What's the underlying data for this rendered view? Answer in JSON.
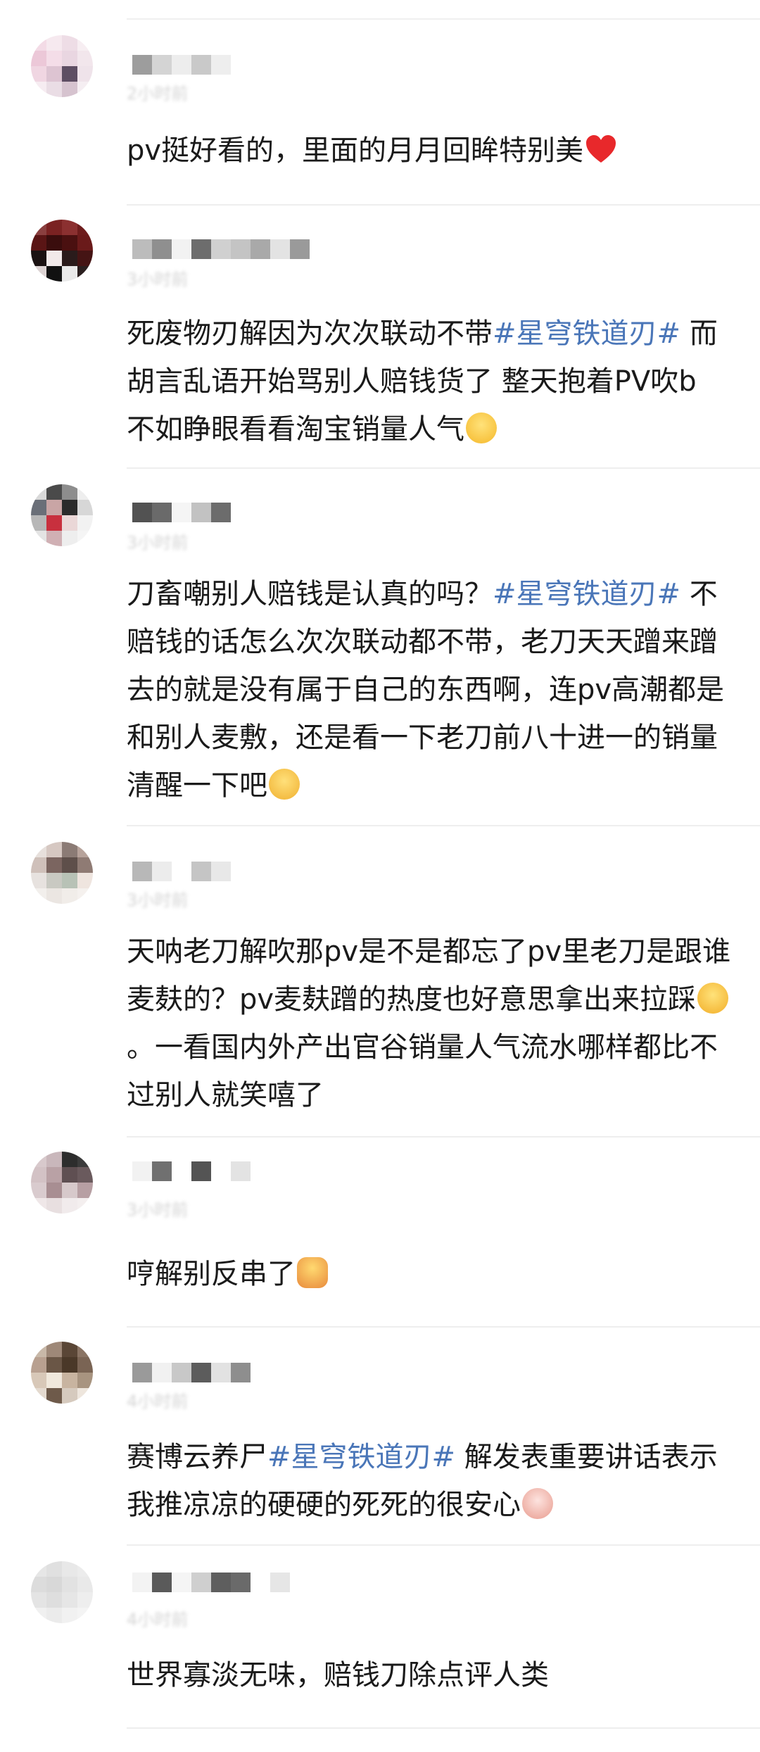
{
  "comments": [
    {
      "time": "2小时前",
      "text": "pv挺好看的，里面的月月回眸特别美",
      "emoji": "heart-emoji"
    },
    {
      "time": "3小时前",
      "text_before": "死废物刃解因为次次联动不带",
      "topic": "#星穹铁道刃#",
      "text_after": " 而胡言乱语开始骂别人赔钱货了 整天抱着PV吹b 不如睁眼看看淘宝销量人气",
      "emoji": "smile-emoji"
    },
    {
      "time": "3小时前",
      "text_before": "刀畜嘲别人赔钱是认真的吗？",
      "topic": "#星穹铁道刃#",
      "text_after": " 不赔钱的话怎么次次联动都不带，老刀天天蹭来蹭去的就是没有属于自己的东西啊，连pv高潮都是和别人麦敷，还是看一下老刀前八十进一的销量清醒一下吧",
      "emoji": "thinking-emoji"
    },
    {
      "time": "3小时前",
      "text_before": "天呐老刀解吹那pv是不是都忘了pv里老刀是跟谁麦麸的？pv麦麸蹭的热度也好意思拿出来拉踩",
      "emoji": "shocked-emoji",
      "text_after": "。一看国内外产出官谷销量人气流水哪样都比不过别人就笑嘻了"
    },
    {
      "time": "3小时前",
      "text": "哼解别反串了",
      "emoji": "fighting-emoji"
    },
    {
      "time": "4小时前",
      "text_before": "赛博云养尸",
      "topic": "#星穹铁道刃#",
      "text_after": " 解发表重要讲话表示我推凉凉的硬硬的死死的很安心",
      "emoji": "scream-emoji"
    },
    {
      "time": "4小时前",
      "text": "世界寡淡无味，赔钱刀除点评人类"
    }
  ]
}
